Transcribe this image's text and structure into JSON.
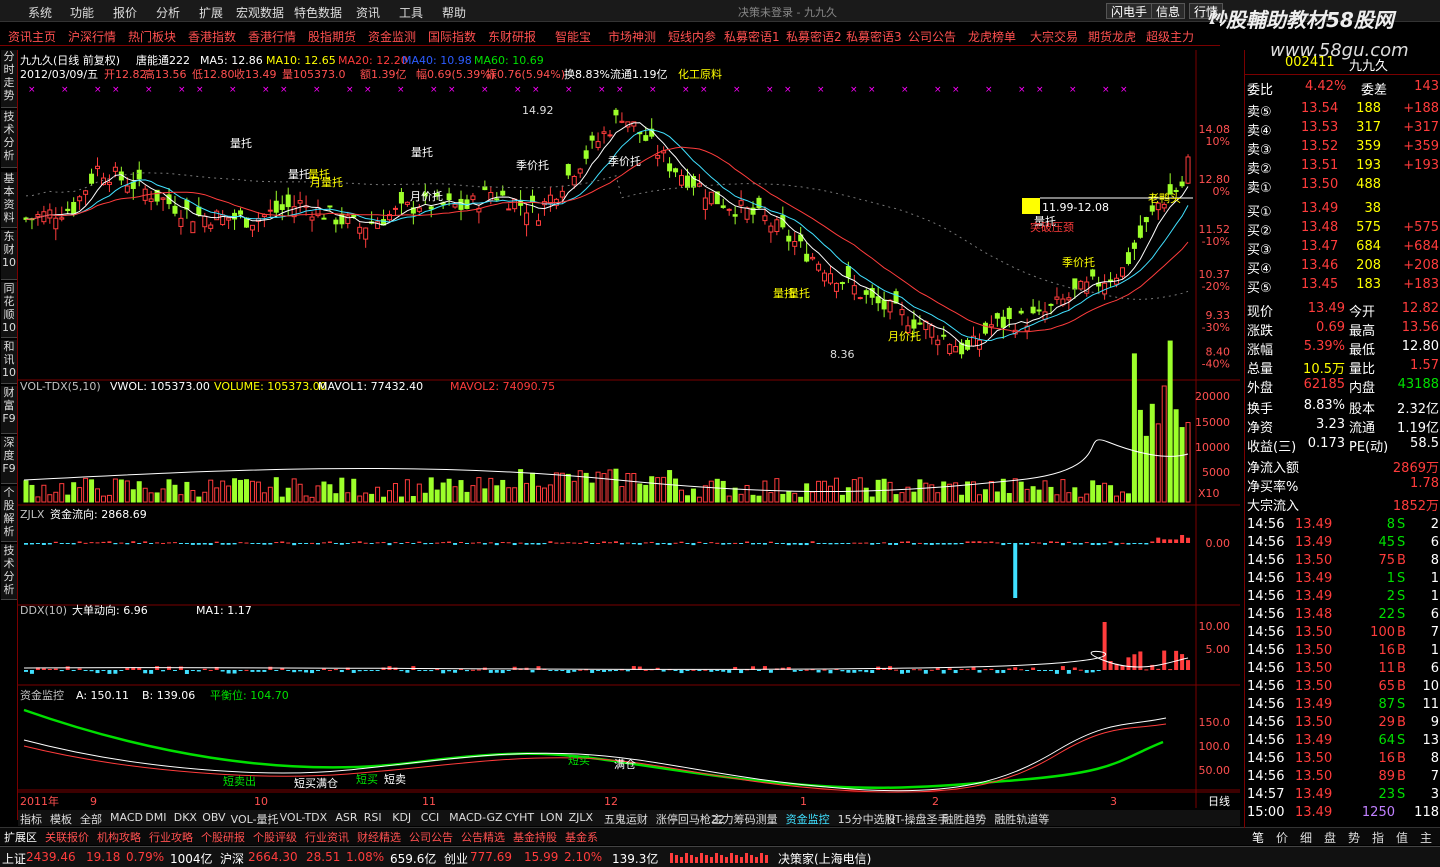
{
  "menu": {
    "items": [
      "系统",
      "功能",
      "报价",
      "分析",
      "扩展",
      "宏观数据",
      "特色数据",
      "资讯",
      "工具",
      "帮助"
    ],
    "title": "决策未登录 - 九九久",
    "right": [
      "闪电手",
      "信息",
      "行情"
    ]
  },
  "watermark": {
    "main": "炒股輔助教材58股网",
    "url": "www.58gu.com"
  },
  "toolbar": {
    "items": [
      "资讯主页",
      "沪深行情",
      "热门板块",
      "香港指数",
      "香港行情",
      "股指期货",
      "资金监测",
      "国际指数",
      "东财研报",
      "智能宝",
      "市场神测",
      "短线内参",
      "私募密语1",
      "私募密语2",
      "私募密语3",
      "公司公告",
      "龙虎榜单",
      "大宗交易",
      "期货龙虎",
      "超级主力"
    ]
  },
  "left_tabs": [
    "分时走势",
    "技术分析",
    "基本资料",
    "东财10",
    "同花顺10",
    "和讯10",
    "财富F9",
    "深度F9",
    "个股解析",
    "技术分析"
  ],
  "main": {
    "name": "九九久(日线 前复权)",
    "indicator": "唐能通222",
    "ma": [
      {
        "label": "MA5: 12.86",
        "color": "#ffffff"
      },
      {
        "label": "MA10: 12.65",
        "color": "#ffff00"
      },
      {
        "label": "MA20: 12.20",
        "color": "#ff3c3c"
      },
      {
        "label": "MA40: 10.98",
        "color": "#2c5cff"
      },
      {
        "label": "MA60: 10.69",
        "color": "#00e000"
      }
    ],
    "info": [
      "2012/03/09/五",
      "开12.82",
      "高13.56",
      "低12.80",
      "收13.49",
      "量105373.0",
      "额1.39亿",
      "幅0.69(5.39%)",
      "振0.76(5.94%)",
      "换8.83%",
      "流通1.19亿",
      "化工原料"
    ],
    "price_labels": [
      "14.08",
      "12.80",
      "11.52",
      "10.37",
      "9.33",
      "8.40"
    ],
    "pct_labels": [
      "10%",
      "0%",
      "-10%",
      "-20%",
      "-30%",
      "-40%"
    ],
    "annotations": [
      "量托",
      "量托",
      "量托",
      "量托",
      "量托",
      "月量托",
      "月价托",
      "月价托",
      "季价托",
      "季价托",
      "季价托",
      "量托",
      "量托"
    ],
    "high_label": "14.92",
    "low_label": "8.36",
    "line_label": "11.99-12.08",
    "old_label": "老鸭头",
    "break_label": "突破压颈"
  },
  "vol": {
    "title": "VOL-TDX(5,10)",
    "vals": [
      "VWOL: 105373.00",
      "VOLUME: 105373.00",
      "MAVOL1: 77432.40",
      "MAVOL2: 74090.75"
    ],
    "axis": [
      "20000",
      "15000",
      "10000",
      "5000"
    ],
    "unit": "X10"
  },
  "zjlx": {
    "title": "ZJLX",
    "vals": [
      "资金流向: 2868.69"
    ],
    "axis": [
      "0.00"
    ]
  },
  "ddx": {
    "title": "DDX(10)",
    "vals": [
      "大单动向: 6.96",
      "MA1: 1.17"
    ],
    "axis": [
      "10.00",
      "5.00"
    ]
  },
  "zjjk": {
    "title": "资金监控",
    "vals": [
      "A: 150.11",
      "B: 139.06",
      "平衡位: 104.70"
    ],
    "axis": [
      "150.0",
      "100.0",
      "50.00"
    ],
    "marks": [
      "短卖出",
      "短买满仓",
      "短买",
      "短卖",
      "短买",
      "满仓"
    ]
  },
  "dates": [
    "2011年",
    "9",
    "10",
    "11",
    "12",
    "1",
    "2",
    "3"
  ],
  "period": "日线",
  "bottom_tabs": [
    "指标",
    "模板",
    "全部",
    "MACD",
    "DMI",
    "DKX",
    "OBV",
    "VOL-量托",
    "VOL-TDX",
    "ASR",
    "RSI",
    "KDJ",
    "CCI",
    "MACD-GZ",
    "CYHT",
    "LON",
    "ZJLX",
    "五鬼运财",
    "涨停回马枪22",
    "主力筹码测量",
    "资金监控",
    "15分中选股",
    "HT-操盘圣手",
    "融胜趋势",
    "融胜轨道等"
  ],
  "bottom_links": [
    "扩展区",
    "关联报价",
    "机构攻略",
    "行业攻略",
    "个股研报",
    "个股评级",
    "行业资讯",
    "财经精选",
    "公司公告",
    "公告精选",
    "基金持股",
    "基金系"
  ],
  "status": {
    "sh": {
      "label": "上证",
      "val": "2439.46",
      "chg": "19.18",
      "pct": "0.79%",
      "amt": "1004亿"
    },
    "sz": {
      "label": "沪深",
      "val": "2664.30",
      "chg": "28.51",
      "pct": "1.08%",
      "amt": "659.6亿"
    },
    "cy": {
      "label": "创业",
      "val": "777.69",
      "chg": "15.99",
      "pct": "2.10%",
      "amt": "139.3亿"
    },
    "app": "决策家(上海电信)"
  },
  "quote": {
    "code": "002411",
    "name": "九九久",
    "wb": {
      "label": "委比",
      "val": "4.42%",
      "diff_label": "委差",
      "diff": "143"
    },
    "asks": [
      {
        "label": "卖⑤",
        "price": "13.54",
        "vol": "188",
        "chg": "+188"
      },
      {
        "label": "卖④",
        "price": "13.53",
        "vol": "317",
        "chg": "+317"
      },
      {
        "label": "卖③",
        "price": "13.52",
        "vol": "359",
        "chg": "+359"
      },
      {
        "label": "卖②",
        "price": "13.51",
        "vol": "193",
        "chg": "+193"
      },
      {
        "label": "卖①",
        "price": "13.50",
        "vol": "488",
        "chg": ""
      }
    ],
    "bids": [
      {
        "label": "买①",
        "price": "13.49",
        "vol": "38",
        "chg": ""
      },
      {
        "label": "买②",
        "price": "13.48",
        "vol": "575",
        "chg": "+575"
      },
      {
        "label": "买③",
        "price": "13.47",
        "vol": "684",
        "chg": "+684"
      },
      {
        "label": "买④",
        "price": "13.46",
        "vol": "208",
        "chg": "+208"
      },
      {
        "label": "买⑤",
        "price": "13.45",
        "vol": "183",
        "chg": "+183"
      }
    ],
    "stats": [
      [
        {
          "k": "现价",
          "v": "13.49",
          "c": "r"
        },
        {
          "k": "今开",
          "v": "12.82",
          "c": "r"
        }
      ],
      [
        {
          "k": "涨跌",
          "v": "0.69",
          "c": "r"
        },
        {
          "k": "最高",
          "v": "13.56",
          "c": "r"
        }
      ],
      [
        {
          "k": "涨幅",
          "v": "5.39%",
          "c": "r"
        },
        {
          "k": "最低",
          "v": "12.80",
          "c": "w"
        }
      ],
      [
        {
          "k": "总量",
          "v": "10.5万",
          "c": "y"
        },
        {
          "k": "量比",
          "v": "1.57",
          "c": "r"
        }
      ],
      [
        {
          "k": "外盘",
          "v": "62185",
          "c": "r"
        },
        {
          "k": "内盘",
          "v": "43188",
          "c": "g"
        }
      ],
      [
        {
          "k": "换手",
          "v": "8.83%",
          "c": "w"
        },
        {
          "k": "股本",
          "v": "2.32亿",
          "c": "w"
        }
      ],
      [
        {
          "k": "净资",
          "v": "3.23",
          "c": "w"
        },
        {
          "k": "流通",
          "v": "1.19亿",
          "c": "w"
        }
      ],
      [
        {
          "k": "收益(三)",
          "v": "0.173",
          "c": "w"
        },
        {
          "k": "PE(动)",
          "v": "58.5",
          "c": "w"
        }
      ]
    ],
    "flow": [
      {
        "k": "净流入额",
        "v": "2869万"
      },
      {
        "k": "净买率%",
        "v": "1.78"
      },
      {
        "k": "大宗流入",
        "v": "1852万"
      }
    ],
    "ticks": [
      {
        "t": "14:56",
        "p": "13.49",
        "v": "8",
        "s": "S",
        "n": "2"
      },
      {
        "t": "14:56",
        "p": "13.49",
        "v": "45",
        "s": "S",
        "n": "6"
      },
      {
        "t": "14:56",
        "p": "13.50",
        "v": "75",
        "s": "B",
        "n": "8"
      },
      {
        "t": "14:56",
        "p": "13.49",
        "v": "1",
        "s": "S",
        "n": "1"
      },
      {
        "t": "14:56",
        "p": "13.49",
        "v": "2",
        "s": "S",
        "n": "1"
      },
      {
        "t": "14:56",
        "p": "13.48",
        "v": "22",
        "s": "S",
        "n": "6"
      },
      {
        "t": "14:56",
        "p": "13.50",
        "v": "100",
        "s": "B",
        "n": "7"
      },
      {
        "t": "14:56",
        "p": "13.50",
        "v": "16",
        "s": "B",
        "n": "1"
      },
      {
        "t": "14:56",
        "p": "13.50",
        "v": "11",
        "s": "B",
        "n": "6"
      },
      {
        "t": "14:56",
        "p": "13.50",
        "v": "65",
        "s": "B",
        "n": "10"
      },
      {
        "t": "14:56",
        "p": "13.49",
        "v": "87",
        "s": "S",
        "n": "11"
      },
      {
        "t": "14:56",
        "p": "13.50",
        "v": "29",
        "s": "B",
        "n": "9"
      },
      {
        "t": "14:56",
        "p": "13.49",
        "v": "64",
        "s": "S",
        "n": "13"
      },
      {
        "t": "14:56",
        "p": "13.50",
        "v": "16",
        "s": "B",
        "n": "8"
      },
      {
        "t": "14:56",
        "p": "13.50",
        "v": "89",
        "s": "B",
        "n": "7"
      },
      {
        "t": "14:57",
        "p": "13.49",
        "v": "23",
        "s": "S",
        "n": "3"
      },
      {
        "t": "15:00",
        "p": "13.49",
        "v": "1250",
        "s": "",
        "n": "118"
      }
    ]
  },
  "right_tabs": [
    "笔",
    "价",
    "细",
    "盘",
    "势",
    "指",
    "值",
    "主"
  ]
}
